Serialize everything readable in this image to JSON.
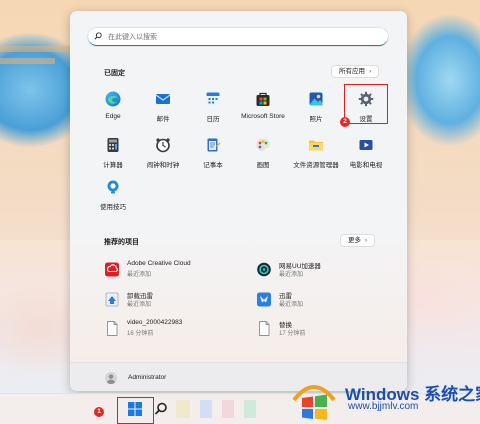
{
  "search": {
    "placeholder": "在此键入以搜索"
  },
  "pinned": {
    "title": "已固定",
    "all_apps_label": "所有应用",
    "apps": [
      {
        "label": "Edge",
        "icon": "edge-icon"
      },
      {
        "label": "邮件",
        "icon": "mail-icon"
      },
      {
        "label": "日历",
        "icon": "calendar-icon"
      },
      {
        "label": "Microsoft Store",
        "icon": "store-icon"
      },
      {
        "label": "照片",
        "icon": "photos-icon"
      },
      {
        "label": "设置",
        "icon": "gear-icon"
      },
      {
        "label": "计算器",
        "icon": "calculator-icon"
      },
      {
        "label": "闹钟和时钟",
        "icon": "alarm-clock-icon"
      },
      {
        "label": "记事本",
        "icon": "notepad-icon"
      },
      {
        "label": "画图",
        "icon": "paint-icon"
      },
      {
        "label": "文件资源管理器",
        "icon": "folder-icon"
      },
      {
        "label": "电影和电视",
        "icon": "film-icon"
      },
      {
        "label": "使用技巧",
        "icon": "tips-icon"
      }
    ]
  },
  "recommended": {
    "title": "推荐的项目",
    "more_label": "更多",
    "items": [
      {
        "name": "Adobe Creative Cloud",
        "sub": "最近添加",
        "icon": "adobe-cc-icon"
      },
      {
        "name": "网易UU加速器",
        "sub": "最近添加",
        "icon": "uu-accelerator-icon"
      },
      {
        "name": "卸载迅雷",
        "sub": "最近添加",
        "icon": "uninstall-icon"
      },
      {
        "name": "迅雷",
        "sub": "最近添加",
        "icon": "thunder-icon"
      },
      {
        "name": "video_2000422983",
        "sub": "16 分钟前",
        "icon": "file-icon"
      },
      {
        "name": "替换",
        "sub": "17 分钟前",
        "icon": "file-icon"
      }
    ]
  },
  "user": {
    "name": "Administrator"
  },
  "annotations": {
    "step1": "1",
    "step2": "2"
  },
  "watermark": {
    "title": "Windows 系统之家",
    "url": "www.bjjmlv.com"
  },
  "colors": {
    "accent": "#1f74d3",
    "highlight": "#d9221c"
  }
}
